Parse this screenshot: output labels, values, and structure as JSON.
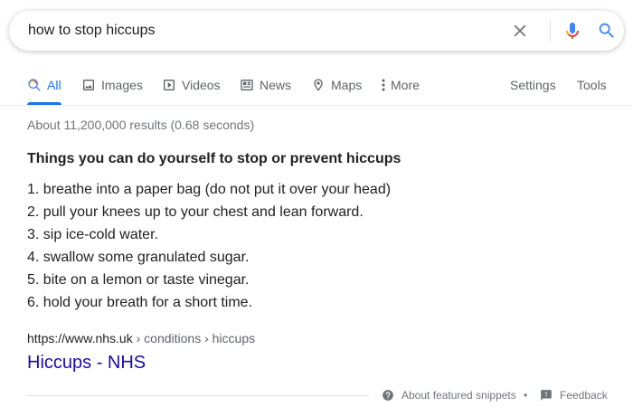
{
  "search": {
    "query": "how to stop hiccups"
  },
  "tabs": {
    "all": "All",
    "images": "Images",
    "videos": "Videos",
    "news": "News",
    "maps": "Maps",
    "more": "More",
    "settings": "Settings",
    "tools": "Tools"
  },
  "stats": "About 11,200,000 results (0.68 seconds)",
  "snippet": {
    "heading": "Things you can do yourself to stop or prevent hiccups",
    "items": [
      "1. breathe into a paper bag (do not put it over your head)",
      "2. pull your knees up to your chest and lean forward.",
      "3. sip ice-cold water.",
      "4. swallow some granulated sugar.",
      "5. bite on a lemon or taste vinegar.",
      "6. hold your breath for a short time."
    ]
  },
  "result": {
    "domain": "https://www.nhs.uk",
    "crumbs": " › conditions › hiccups",
    "title": "Hiccups - NHS"
  },
  "footer": {
    "about": "About featured snippets",
    "separator": "•",
    "feedback": "Feedback"
  },
  "colors": {
    "accent": "#1a73e8",
    "link": "#1a0dab",
    "muted": "#70757a"
  }
}
